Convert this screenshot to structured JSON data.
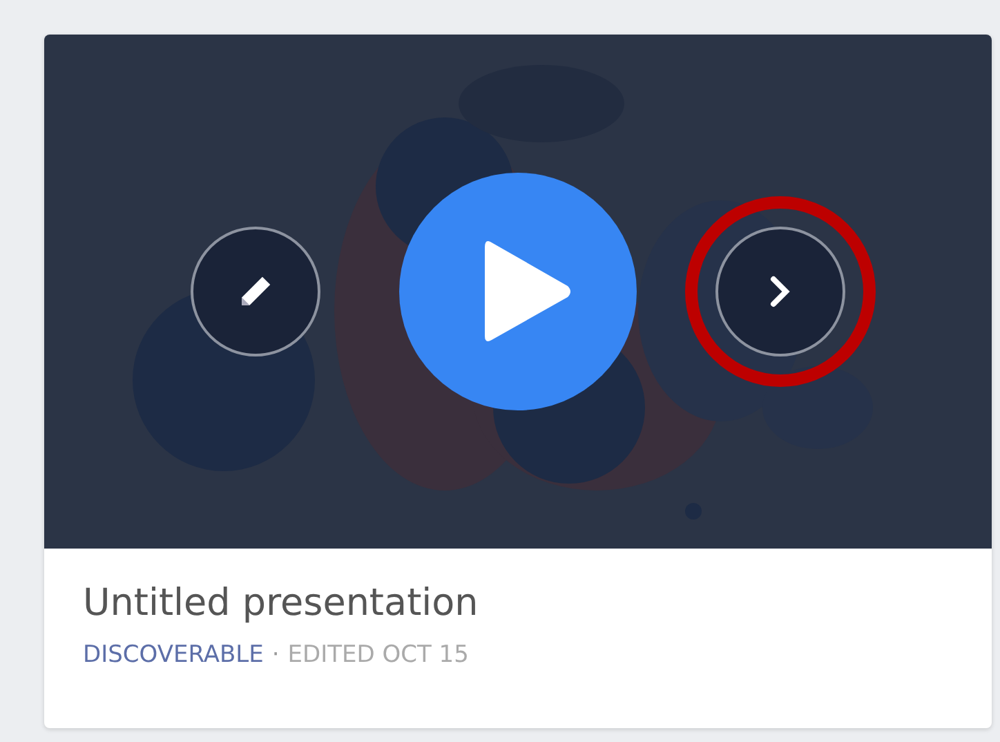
{
  "card": {
    "thumbnail": {
      "buttons": [
        {
          "kind": "edit",
          "highlighted": false
        },
        {
          "kind": "play",
          "highlighted": false
        },
        {
          "kind": "next",
          "highlighted": true
        }
      ]
    },
    "title": "Untitled presentation",
    "visibility": "DISCOVERABLE",
    "separator": "·",
    "edited": "EDITED OCT 15"
  }
}
